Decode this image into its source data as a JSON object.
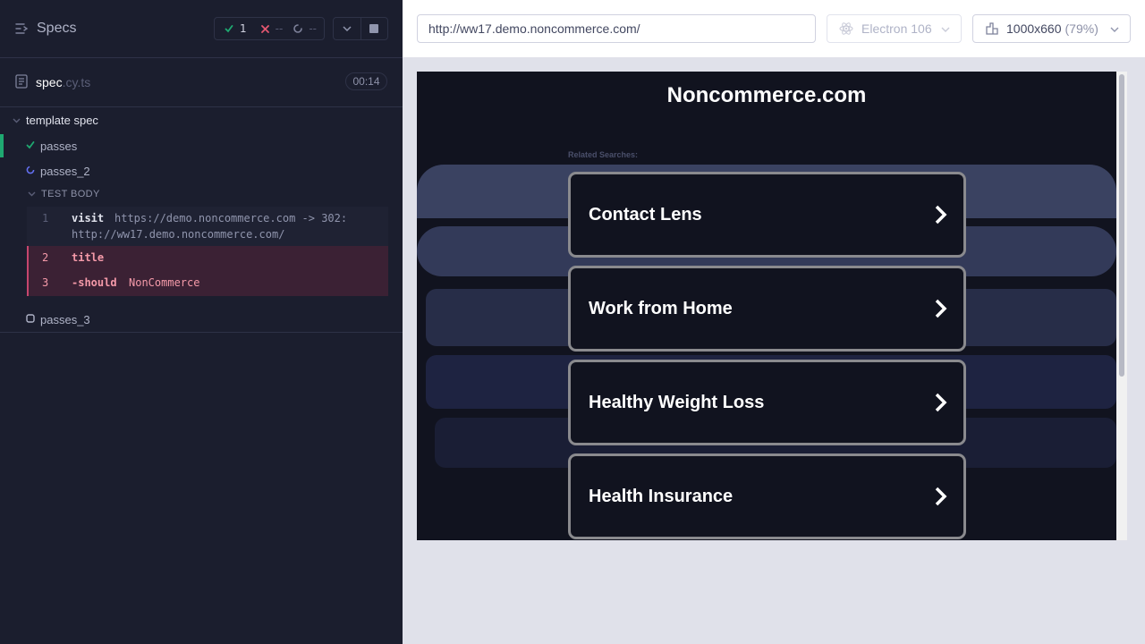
{
  "reporter": {
    "specs_label": "Specs",
    "stats": {
      "passed": "1",
      "failed": "--",
      "pending": "--"
    },
    "spec": {
      "name": "spec",
      "ext": ".cy.ts",
      "duration": "00:14"
    },
    "suite": "template spec",
    "tests": [
      {
        "name": "passes",
        "state": "passed"
      },
      {
        "name": "passes_2",
        "state": "running"
      },
      {
        "name": "passes_3",
        "state": "pending"
      }
    ],
    "test_body_label": "TEST BODY",
    "commands": [
      {
        "num": "1",
        "name": "visit",
        "message": "https://demo.noncommerce.com -> 302:",
        "message2": "http://ww17.demo.noncommerce.com/"
      },
      {
        "num": "2",
        "name": "title",
        "message": ""
      },
      {
        "num": "3",
        "name": "-should",
        "message": "NonCommerce"
      }
    ]
  },
  "aut": {
    "url": "http://ww17.demo.noncommerce.com/",
    "browser": "Electron 106",
    "viewport": "1000x660",
    "scale": "(79%)"
  },
  "site": {
    "title": "Noncommerce.com",
    "related_label": "Related Searches:",
    "links": [
      "Contact Lens",
      "Work from Home",
      "Healthy Weight Loss",
      "Health Insurance"
    ]
  },
  "colors": {
    "pass": "#1fa971",
    "fail": "#e45770",
    "running": "#6470f3",
    "error_bg": "#3b2134",
    "site_bg": "#11131f"
  }
}
